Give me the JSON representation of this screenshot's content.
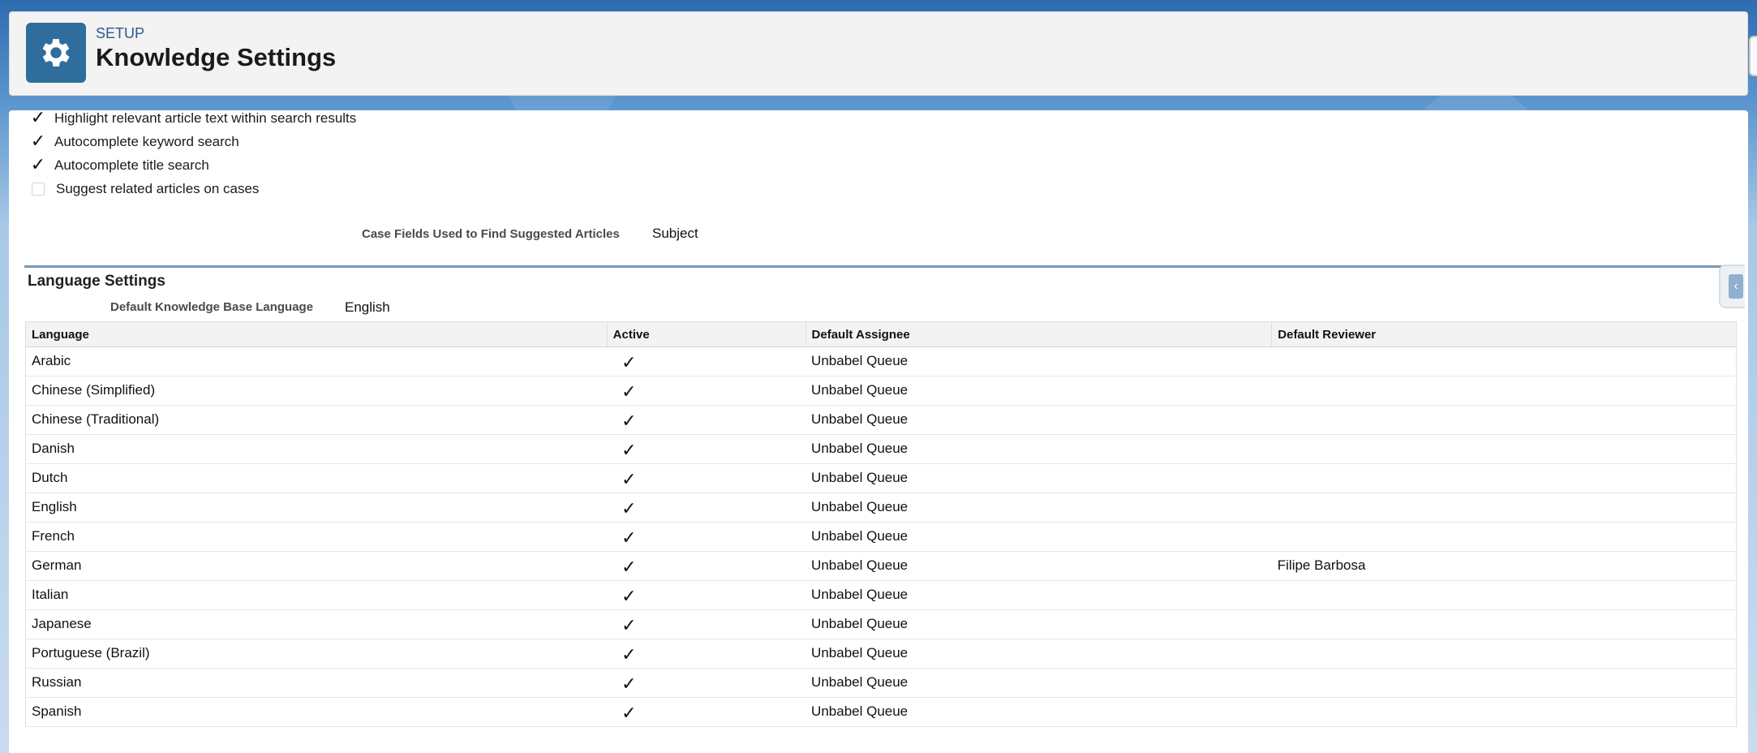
{
  "header": {
    "kicker": "SETUP",
    "title": "Knowledge Settings",
    "icon": "gear-icon"
  },
  "options": [
    {
      "label": "Highlight relevant article text within search results",
      "checked": true
    },
    {
      "label": "Autocomplete keyword search",
      "checked": true
    },
    {
      "label": "Autocomplete title search",
      "checked": true
    },
    {
      "label": "Suggest related articles on cases",
      "checked": false
    }
  ],
  "case_fields": {
    "label": "Case Fields Used to Find Suggested Articles",
    "value": "Subject"
  },
  "language_settings": {
    "title": "Language Settings",
    "default_label": "Default Knowledge Base Language",
    "default_value": "English",
    "columns": [
      "Language",
      "Active",
      "Default Assignee",
      "Default Reviewer"
    ],
    "rows": [
      {
        "language": "Arabic",
        "active": "✓",
        "assignee": "Unbabel Queue",
        "reviewer": ""
      },
      {
        "language": "Chinese (Simplified)",
        "active": "✓",
        "assignee": "Unbabel Queue",
        "reviewer": ""
      },
      {
        "language": "Chinese (Traditional)",
        "active": "✓",
        "assignee": "Unbabel Queue",
        "reviewer": ""
      },
      {
        "language": "Danish",
        "active": "✓",
        "assignee": "Unbabel Queue",
        "reviewer": ""
      },
      {
        "language": "Dutch",
        "active": "✓",
        "assignee": "Unbabel Queue",
        "reviewer": ""
      },
      {
        "language": "English",
        "active": "✓",
        "assignee": "Unbabel Queue",
        "reviewer": ""
      },
      {
        "language": "French",
        "active": "✓",
        "assignee": "Unbabel Queue",
        "reviewer": ""
      },
      {
        "language": "German",
        "active": "✓",
        "assignee": "Unbabel Queue",
        "reviewer": "Filipe Barbosa"
      },
      {
        "language": "Italian",
        "active": "✓",
        "assignee": "Unbabel Queue",
        "reviewer": ""
      },
      {
        "language": "Japanese",
        "active": "✓",
        "assignee": "Unbabel Queue",
        "reviewer": ""
      },
      {
        "language": "Portuguese (Brazil)",
        "active": "✓",
        "assignee": "Unbabel Queue",
        "reviewer": ""
      },
      {
        "language": "Russian",
        "active": "✓",
        "assignee": "Unbabel Queue",
        "reviewer": ""
      },
      {
        "language": "Spanish",
        "active": "✓",
        "assignee": "Unbabel Queue",
        "reviewer": ""
      }
    ]
  },
  "colors": {
    "header_icon_bg": "#2f6d9c",
    "kicker": "#2b5a8c",
    "section_rule": "#7c97b6"
  }
}
